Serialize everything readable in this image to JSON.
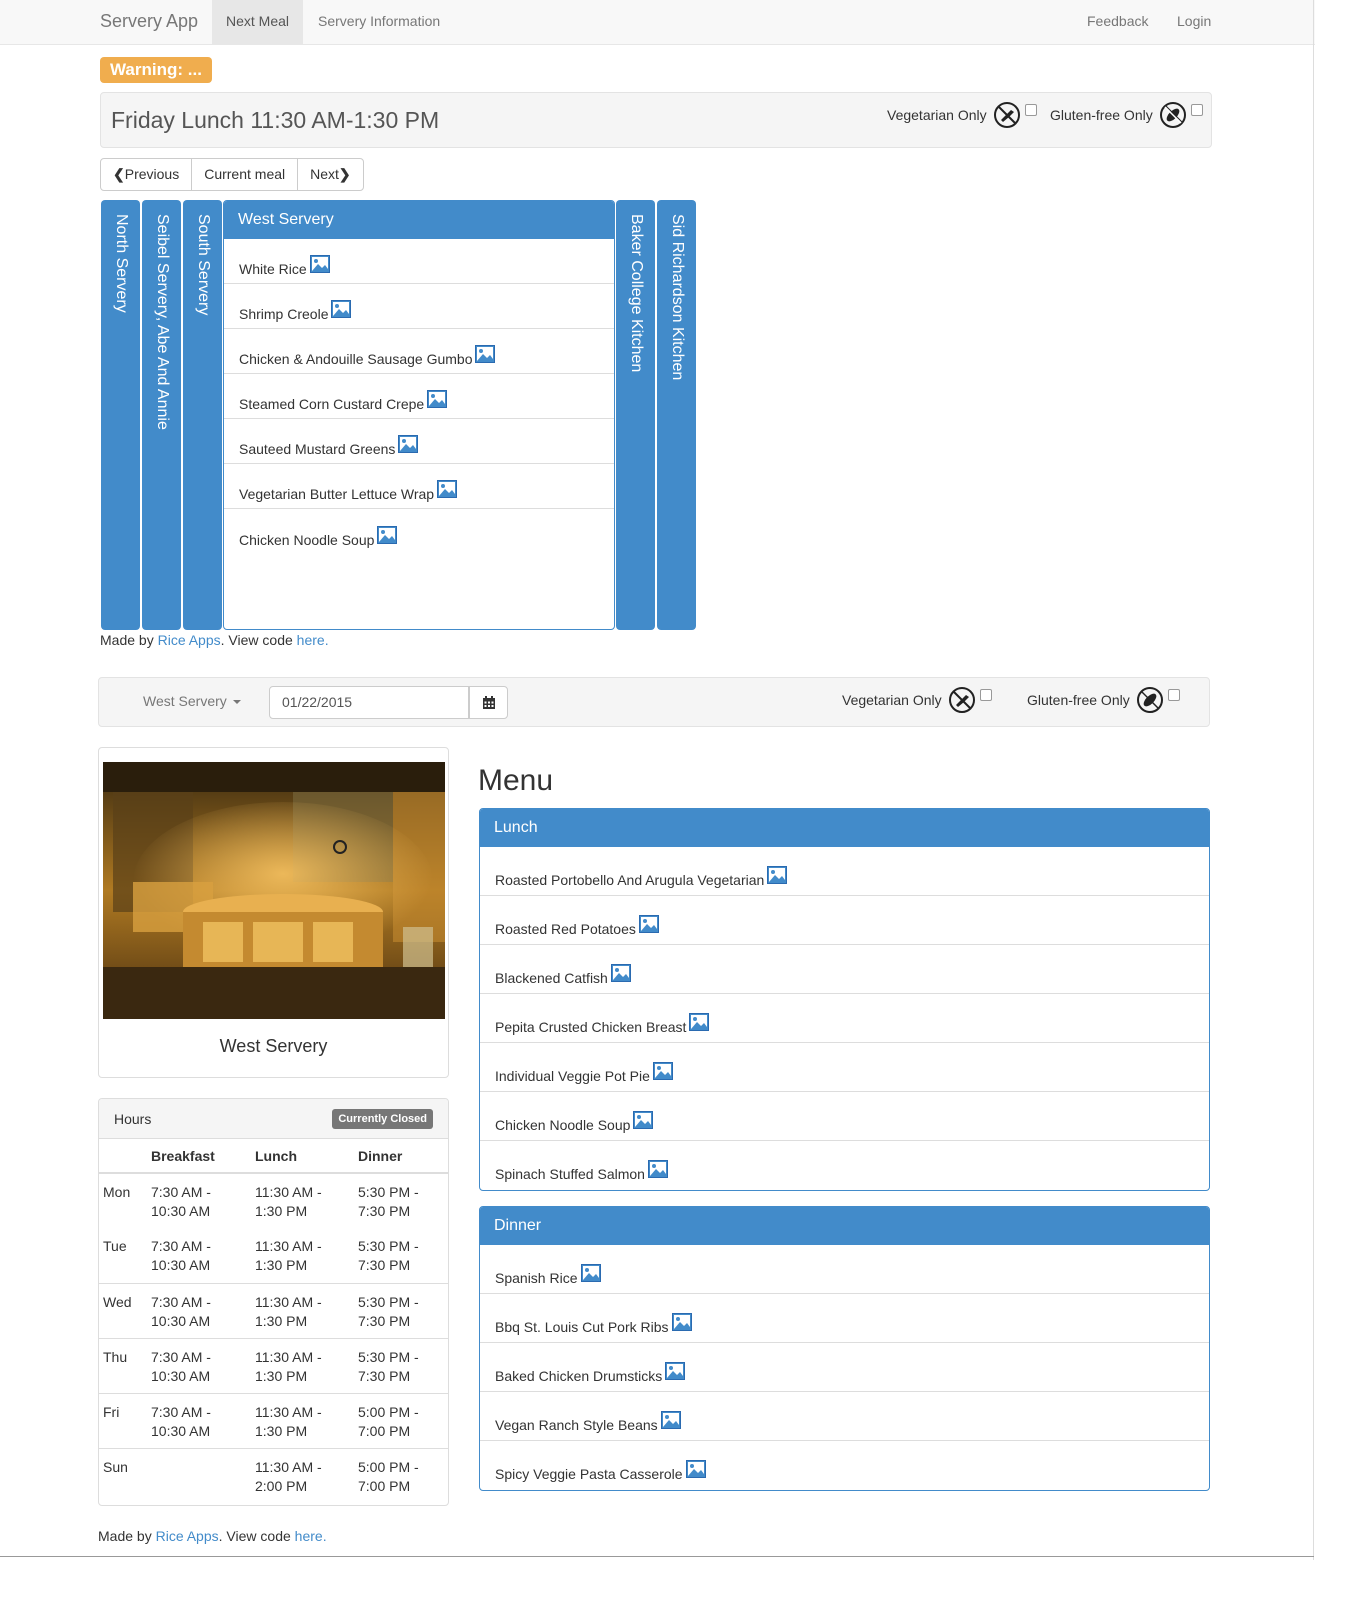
{
  "nav": {
    "brand": "Servery App",
    "next_meal": "Next Meal",
    "servery_info": "Servery Information",
    "feedback": "Feedback",
    "login": "Login"
  },
  "warning": "Warning: ...",
  "meal": {
    "title": "Friday Lunch 11:30 AM-1:30 PM",
    "vegetarian_label": "Vegetarian Only",
    "gluten_free_label": "Gluten-free Only",
    "vegetarian_checked": false,
    "gluten_free_checked": false
  },
  "pager": {
    "previous": "Previous",
    "current": "Current meal",
    "next": "Next"
  },
  "serveries": {
    "left_tabs": [
      "North Servery",
      "Seibel Servery, Abe And Annie",
      "South Servery"
    ],
    "right_tabs": [
      "Baker College Kitchen",
      "Sid Richardson Kitchen"
    ],
    "active": {
      "name": "West Servery",
      "items": [
        "White Rice",
        "Shrimp Creole",
        "Chicken & Andouille Sausage Gumbo",
        "Steamed Corn Custard Crepe",
        "Sauteed Mustard Greens",
        "Vegetarian Butter Lettuce Wrap",
        "Chicken Noodle Soup"
      ]
    }
  },
  "footer": {
    "made_by": "Made by ",
    "rice_apps": "Rice Apps",
    "view_code": ". View code ",
    "here": "here",
    "period": "."
  },
  "info": {
    "servery_select": "West Servery",
    "date": "01/22/2015",
    "vegetarian_label": "Vegetarian Only",
    "gluten_free_label": "Gluten-free Only",
    "caption": "West Servery"
  },
  "hours": {
    "title": "Hours",
    "status": "Currently Closed",
    "columns": [
      "",
      "Breakfast",
      "Lunch",
      "Dinner"
    ],
    "rows": [
      {
        "day": "Mon",
        "breakfast": [
          "7:30 AM -",
          "10:30 AM"
        ],
        "lunch": [
          "11:30 AM -",
          "1:30 PM"
        ],
        "dinner": [
          "5:30 PM -",
          "7:30 PM"
        ]
      },
      {
        "day": "Tue",
        "breakfast": [
          "7:30 AM -",
          "10:30 AM"
        ],
        "lunch": [
          "11:30 AM -",
          "1:30 PM"
        ],
        "dinner": [
          "5:30 PM -",
          "7:30 PM"
        ]
      },
      {
        "day": "Wed",
        "breakfast": [
          "7:30 AM -",
          "10:30 AM"
        ],
        "lunch": [
          "11:30 AM -",
          "1:30 PM"
        ],
        "dinner": [
          "5:30 PM -",
          "7:30 PM"
        ]
      },
      {
        "day": "Thu",
        "breakfast": [
          "7:30 AM -",
          "10:30 AM"
        ],
        "lunch": [
          "11:30 AM -",
          "1:30 PM"
        ],
        "dinner": [
          "5:30 PM -",
          "7:30 PM"
        ]
      },
      {
        "day": "Fri",
        "breakfast": [
          "7:30 AM -",
          "10:30 AM"
        ],
        "lunch": [
          "11:30 AM -",
          "1:30 PM"
        ],
        "dinner": [
          "5:00 PM -",
          "7:00 PM"
        ]
      },
      {
        "day": "Sun",
        "breakfast": [
          "",
          ""
        ],
        "lunch": [
          "11:30 AM -",
          "2:00 PM"
        ],
        "dinner": [
          "5:00 PM -",
          "7:00 PM"
        ]
      }
    ]
  },
  "menu": {
    "title": "Menu",
    "lunch": {
      "label": "Lunch",
      "items": [
        "Roasted Portobello And Arugula Vegetarian",
        "Roasted Red Potatoes",
        "Blackened Catfish",
        "Pepita Crusted Chicken Breast",
        "Individual Veggie Pot Pie",
        "Chicken Noodle Soup",
        "Spinach Stuffed Salmon"
      ]
    },
    "dinner": {
      "label": "Dinner",
      "items": [
        "Spanish Rice",
        "Bbq St. Louis Cut Pork Ribs",
        "Baked Chicken Drumsticks",
        "Vegan Ranch Style Beans",
        "Spicy Veggie Pasta Casserole"
      ]
    }
  },
  "colors": {
    "primary": "#428bca",
    "warning": "#f0ad4e",
    "badge": "#777777"
  }
}
